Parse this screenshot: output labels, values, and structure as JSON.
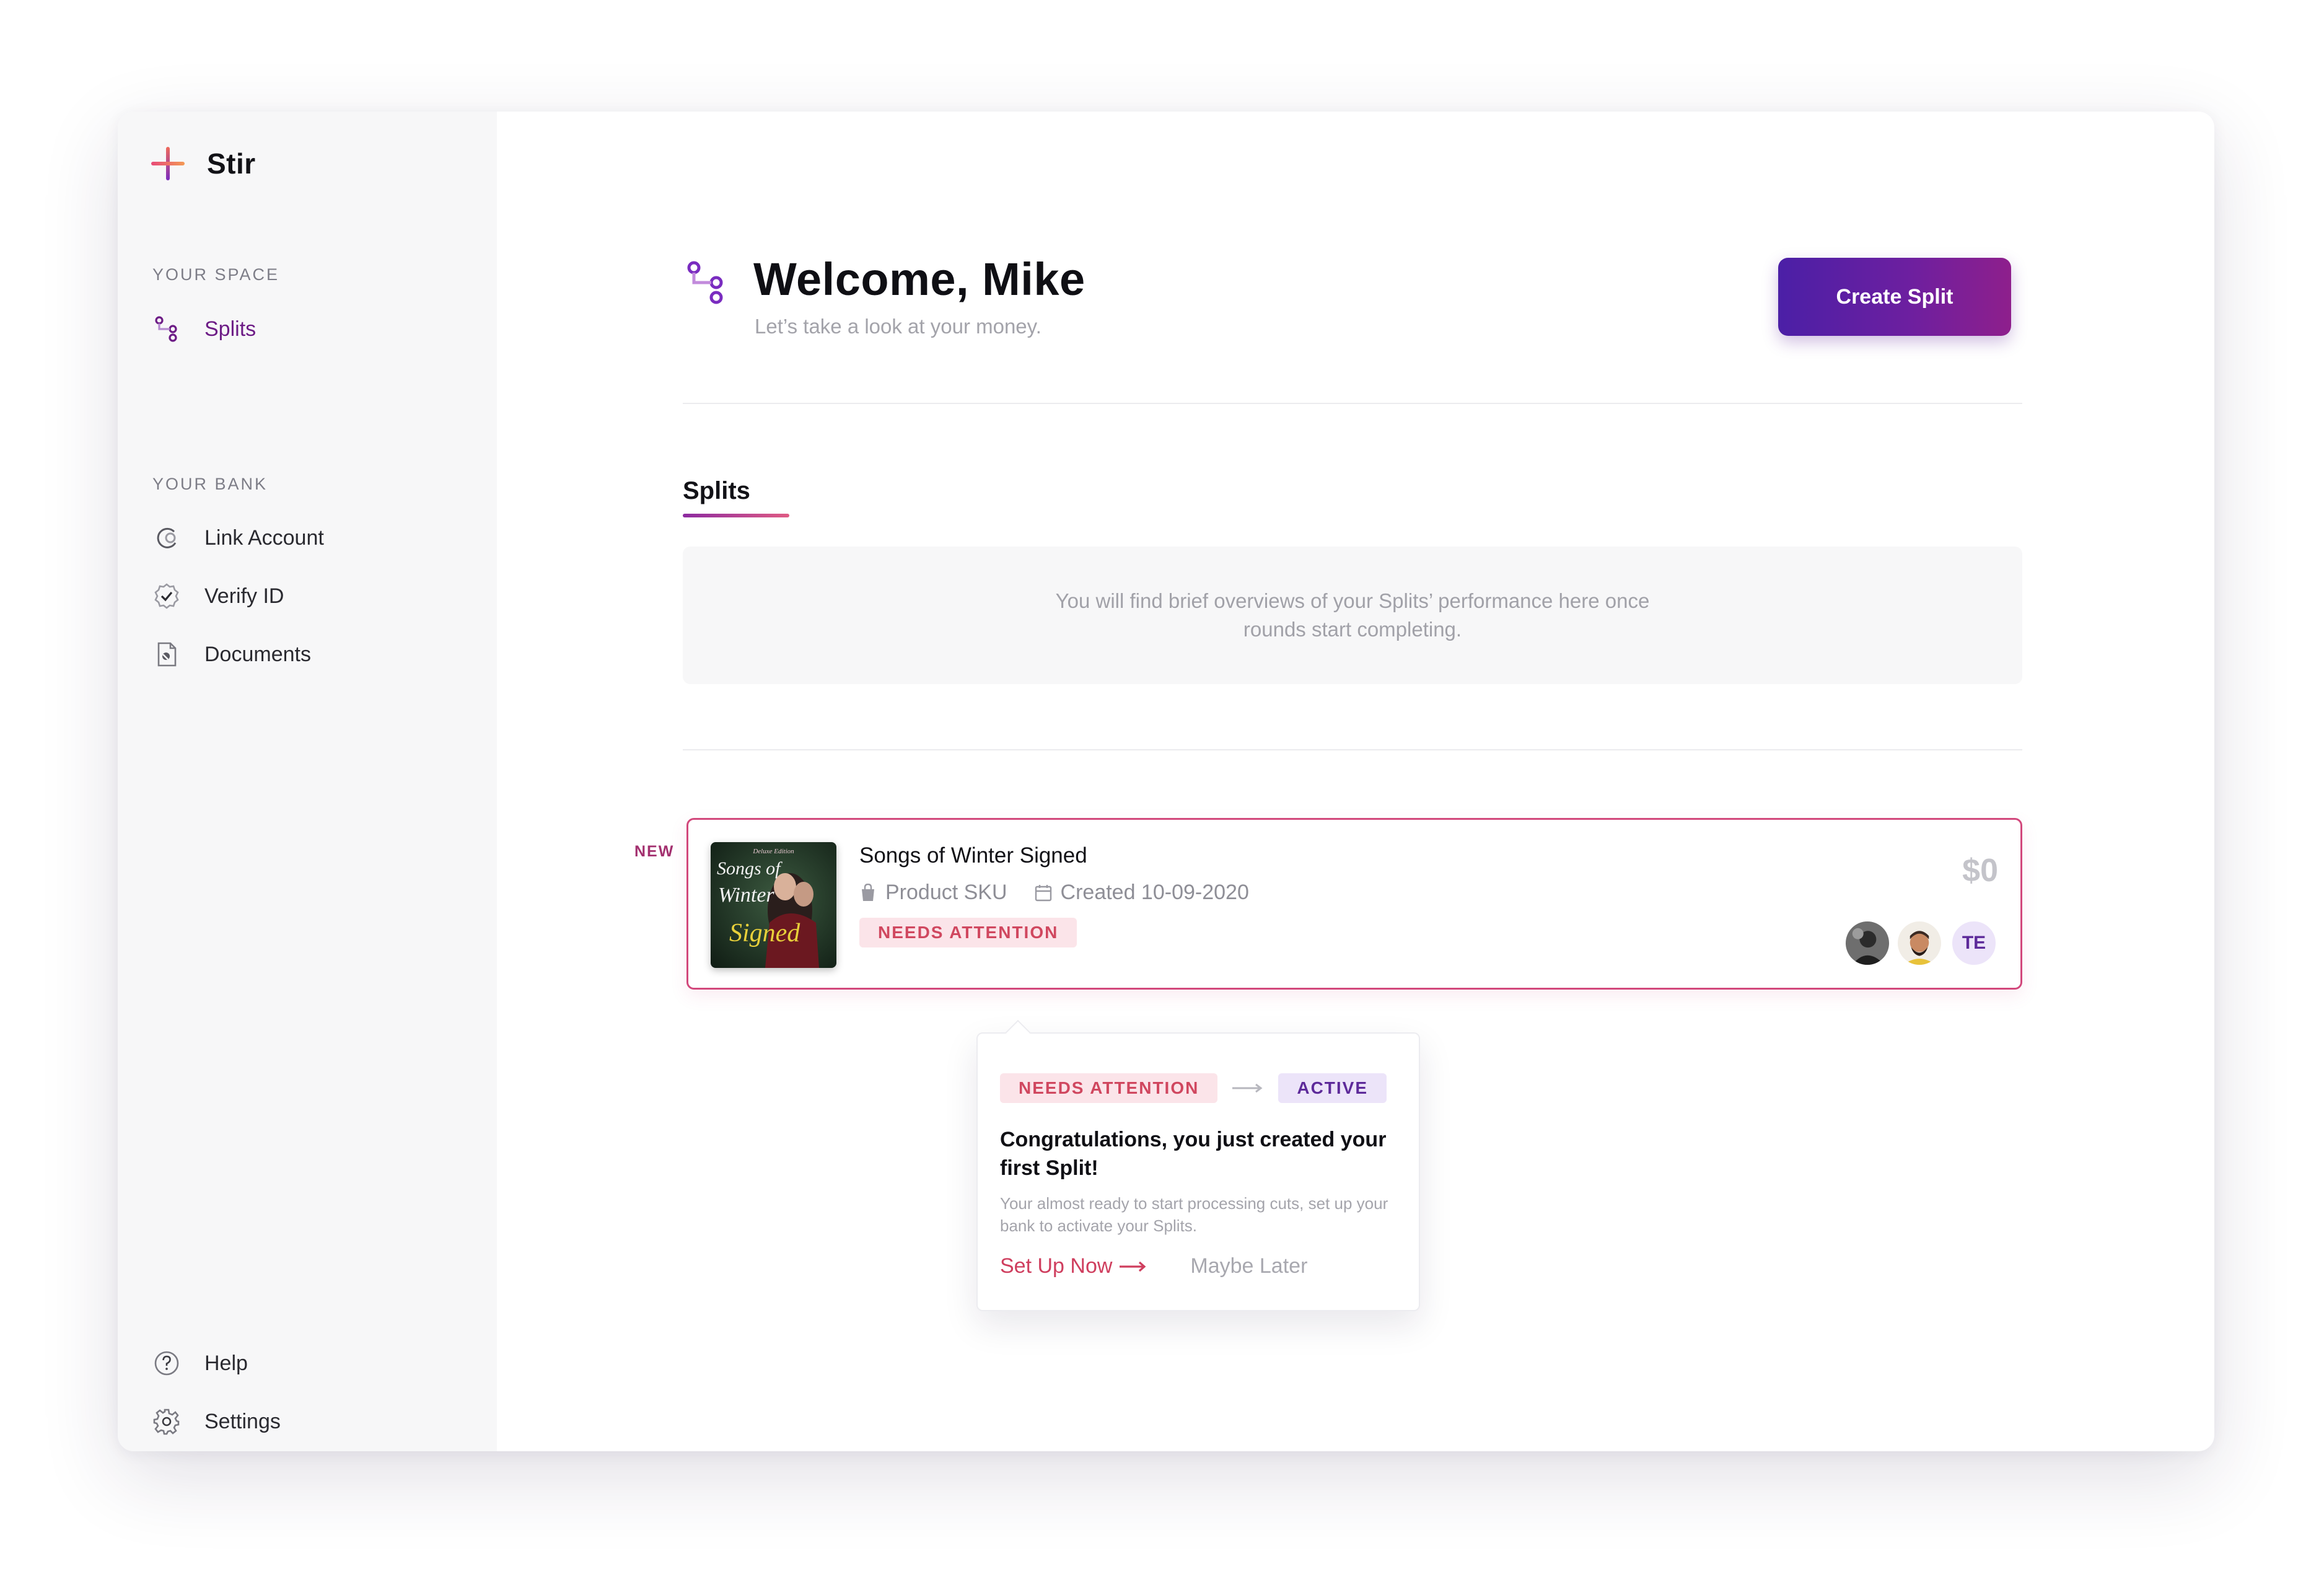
{
  "app": {
    "name": "Stir"
  },
  "sidebar": {
    "your_space_label": "YOUR SPACE",
    "splits_label": "Splits",
    "your_bank_label": "YOUR BANK",
    "link_account_label": "Link Account",
    "verify_id_label": "Verify ID",
    "documents_label": "Documents",
    "help_label": "Help",
    "settings_label": "Settings"
  },
  "header": {
    "welcome": "Welcome, Mike",
    "subtitle": "Let’s take a look at your money.",
    "create_button": "Create Split"
  },
  "tabs": {
    "splits": "Splits"
  },
  "empty_state": {
    "text": "You will find brief overviews of your Splits’ performance here once rounds start completing."
  },
  "split_card": {
    "new_tag": "NEW",
    "title": "Songs of Winter Signed",
    "sku": "Product SKU",
    "created": "Created 10-09-2020",
    "status": "NEEDS ATTENTION",
    "amount": "$0",
    "album_art": {
      "top_text": "Deluxe Edition",
      "title_line1": "Songs of",
      "title_line2": "Winter",
      "title_line3": "Signed"
    },
    "avatar_initials": "TE"
  },
  "popover": {
    "from_status": "NEEDS ATTENTION",
    "to_status": "ACTIVE",
    "title": "Congratulations, you just created your first Split!",
    "text": "Your almost ready to start processing cuts, set up your bank to activate your Splits.",
    "setup_label": "Set Up Now",
    "later_label": "Maybe Later"
  },
  "colors": {
    "accent_purple": "#6d1c86",
    "button_gradient_start": "#4b1fa6",
    "button_gradient_end": "#8e1f8c",
    "attention_red": "#d0475f",
    "card_border": "#d2487c",
    "sidebar_bg": "#f7f7f8"
  },
  "icons": {
    "logo": "stir-cross-logo",
    "splits": "split-nodes-icon",
    "link_account": "link-circle-icon",
    "verify_id": "verified-badge-icon",
    "documents": "document-icon",
    "help": "help-circle-icon",
    "settings": "gear-icon",
    "sku": "shopping-bag-icon",
    "created": "calendar-icon"
  }
}
